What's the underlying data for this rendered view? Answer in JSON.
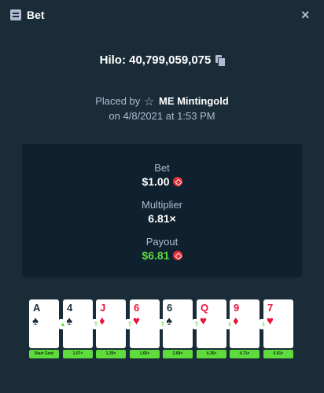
{
  "header": {
    "icon": "bet-ticket-icon",
    "title": "Bet",
    "close_icon": "close-icon",
    "close_label": "×"
  },
  "game": {
    "label": "Hilo: 40,799,059,075",
    "copy_icon": "copy-icon"
  },
  "placed": {
    "prefix": "Placed by",
    "star": "☆",
    "user": "ME Mintingold",
    "date": "on 4/8/2021 at 1:53 PM"
  },
  "stats": {
    "bet_label": "Bet",
    "bet_value": "$1.00",
    "multiplier_label": "Multiplier",
    "multiplier_value": "6.81×",
    "payout_label": "Payout",
    "payout_value": "$6.81",
    "currency_icon": "trx-coin-icon",
    "payout_color": "#5ddc3c"
  },
  "cards": [
    {
      "rank": "A",
      "suit": "♠",
      "color": "black",
      "multiplier": "Start Card",
      "arrow": ""
    },
    {
      "rank": "4",
      "suit": "♠",
      "color": "black",
      "multiplier": "1.07×",
      "arrow": "▲"
    },
    {
      "rank": "J",
      "suit": "♦",
      "color": "red",
      "multiplier": "1.39×",
      "arrow": "⇑"
    },
    {
      "rank": "6",
      "suit": "♥",
      "color": "red",
      "multiplier": "1.65×",
      "arrow": "⇑"
    },
    {
      "rank": "6",
      "suit": "♠",
      "color": "black",
      "multiplier": "2.68×",
      "arrow": "⇑"
    },
    {
      "rank": "Q",
      "suit": "♥",
      "color": "red",
      "multiplier": "4.35×",
      "arrow": "⇑"
    },
    {
      "rank": "9",
      "suit": "♦",
      "color": "red",
      "multiplier": "4.71×",
      "arrow": "⇓"
    },
    {
      "rank": "7",
      "suit": "♥",
      "color": "red",
      "multiplier": "6.81×",
      "arrow": "⇓"
    }
  ]
}
